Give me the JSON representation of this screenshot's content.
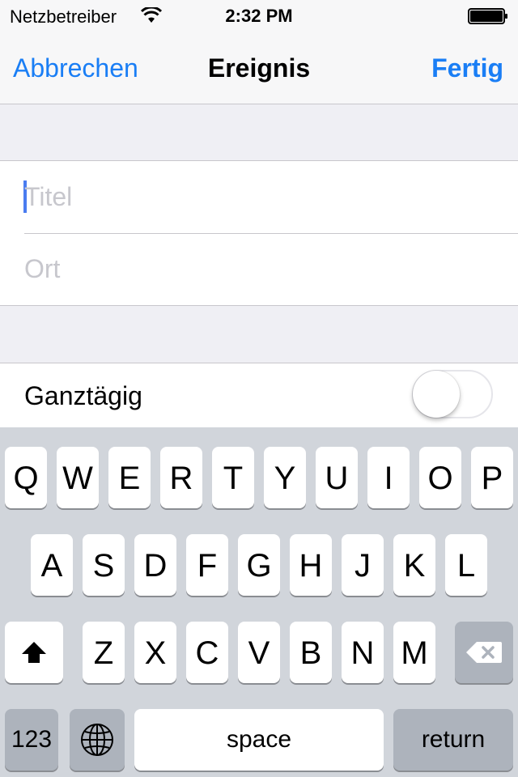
{
  "status_bar": {
    "carrier": "Netzbetreiber",
    "time": "2:32 PM"
  },
  "nav": {
    "cancel_label": "Abbrechen",
    "title": "Ereignis",
    "done_label": "Fertig"
  },
  "fields": {
    "title_placeholder": "Titel",
    "location_placeholder": "Ort"
  },
  "all_day": {
    "label": "Ganztägig",
    "on": false
  },
  "keyboard": {
    "row1": [
      "Q",
      "W",
      "E",
      "R",
      "T",
      "Y",
      "U",
      "I",
      "O",
      "P"
    ],
    "row2": [
      "A",
      "S",
      "D",
      "F",
      "G",
      "H",
      "J",
      "K",
      "L"
    ],
    "row3": [
      "Z",
      "X",
      "C",
      "V",
      "B",
      "N",
      "M"
    ],
    "numbers_label": "123",
    "space_label": "space",
    "return_label": "return",
    "shift_icon": "shift-arrow-icon",
    "delete_icon": "backspace-icon",
    "globe_icon": "globe-icon"
  },
  "colors": {
    "accent": "#1a7ef5",
    "caret": "#4a7cf0",
    "placeholder": "#c7c7cd"
  }
}
